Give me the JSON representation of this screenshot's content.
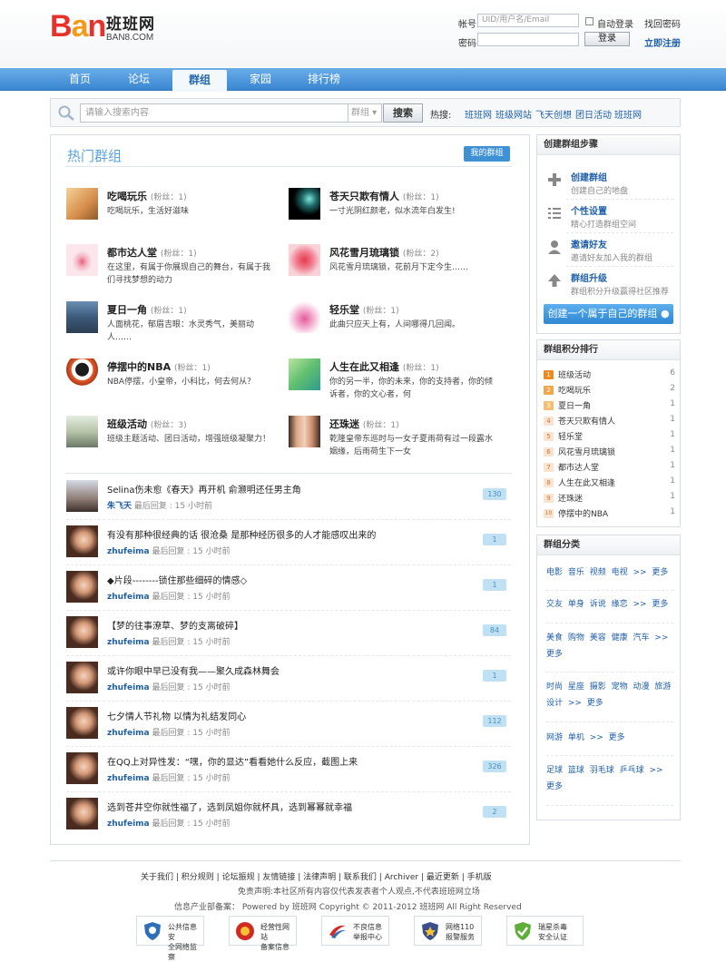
{
  "header": {
    "logo_text": "BAN",
    "logo_cn": "班班网",
    "logo_en": "BAN8.COM",
    "account_label": "帐号",
    "account_placeholder": "UID/用户名/Email",
    "password_label": "密码",
    "auto_login": "自动登录",
    "forgot": "找回密码",
    "login_btn": "登录",
    "register": "立即注册"
  },
  "nav": {
    "items": [
      "首页",
      "论坛",
      "群组",
      "家园",
      "排行榜"
    ],
    "active": "群组"
  },
  "search": {
    "placeholder": "请输入搜索内容",
    "scope": "群组",
    "button": "搜索",
    "hot_label": "热搜:",
    "hot_tags": [
      "班班网",
      "班级网站",
      "飞天创想",
      "团日活动",
      "班班网"
    ]
  },
  "main": {
    "title": "热门群组",
    "mine_btn": "我的群组",
    "fans_label": "粉丝：",
    "groups": [
      {
        "name": "吃喝玩乐",
        "fans": "1",
        "desc": "吃喝玩乐，生活好滋味"
      },
      {
        "name": "苍天只欺有情人",
        "fans": "1",
        "desc": "一寸光阴红颜老，似水流年白发生!"
      },
      {
        "name": "都市达人堂",
        "fans": "1",
        "desc": "在这里，有属于你展现自己的舞台，有属于我们寻找梦想的动力"
      },
      {
        "name": "风花雪月琉璃锁",
        "fans": "2",
        "desc": "风花雪月琉璃锁，花前月下定今生……"
      },
      {
        "name": "夏日一角",
        "fans": "1",
        "desc": "人面桃花，郁眉吉眼：水灵秀气，美丽动人……"
      },
      {
        "name": "轻乐堂",
        "fans": "1",
        "desc": "此曲只应天上有，人间哪得几回闻。"
      },
      {
        "name": "停摆中的NBA",
        "fans": "1",
        "desc": "NBA停摆，小皇帝，小科比，何去何从？"
      },
      {
        "name": "人生在此又相逢",
        "fans": "1",
        "desc": "你的另一半，你的未来，你的支持者，你的倾诉者，你的文心者，何"
      },
      {
        "name": "班级活动",
        "fans": "3",
        "desc": "班级主题活动、团日活动，增强班级凝聚力！"
      },
      {
        "name": "还珠迷",
        "fans": "1",
        "desc": "乾隆皇帝东巡时与一女子夏雨荷有过一段露水姻缘，后雨荷生下一女"
      }
    ],
    "last_reply_label": "最后回复 :",
    "topics": [
      {
        "title": "Selina伤未愈《春天》再开机 俞灏明还任男主角",
        "user": "朱飞天",
        "time": "15 小时前",
        "count": "130"
      },
      {
        "title": "有没有那种很经典的话 很沧桑 是那种经历很多的人才能感叹出来的",
        "user": "zhufeima",
        "time": "15 小时前",
        "count": "1"
      },
      {
        "title": "◆片段--------锁住那些细碎的情感◇",
        "user": "zhufeima",
        "time": "15 小时前",
        "count": "1"
      },
      {
        "title": "【梦的往事潦草、梦的支离破碎】",
        "user": "zhufeima",
        "time": "15 小时前",
        "count": "84"
      },
      {
        "title": "或许你眼中早已没有我——聚久成森林舞会",
        "user": "zhufeima",
        "time": "15 小时前",
        "count": "1"
      },
      {
        "title": "七夕情人节礼物 以情为礼结发同心",
        "user": "zhufeima",
        "time": "15 小时前",
        "count": "112"
      },
      {
        "title": "在QQ上对异性发：“嘿，你的显达”看看她什么反应，截图上来",
        "user": "zhufeima",
        "time": "15 小时前",
        "count": "326"
      },
      {
        "title": "选到苍井空你就性福了，选到凤姐你就杯具，选到幂幂就幸福",
        "user": "zhufeima",
        "time": "15 小时前",
        "count": "2"
      }
    ]
  },
  "steps": {
    "title": "创建群组步骤",
    "items": [
      {
        "title": "创建群组",
        "desc": "创建自己的地盘"
      },
      {
        "title": "个性设置",
        "desc": "精心打造群组空间"
      },
      {
        "title": "邀请好友",
        "desc": "邀请好友加入我的群组"
      },
      {
        "title": "群组升级",
        "desc": "群组积分升级赢得社区推荐"
      }
    ],
    "create_btn": "创建一个属于自己的群组"
  },
  "ranking": {
    "title": "群组积分排行",
    "items": [
      {
        "rank": "1",
        "name": "班级活动",
        "score": "6"
      },
      {
        "rank": "2",
        "name": "吃喝玩乐",
        "score": "2"
      },
      {
        "rank": "3",
        "name": "夏日一角",
        "score": "1"
      },
      {
        "rank": "4",
        "name": "苍天只欺有情人",
        "score": "1"
      },
      {
        "rank": "5",
        "name": "轻乐堂",
        "score": "1"
      },
      {
        "rank": "6",
        "name": "风花雪月琉璃锁",
        "score": "1"
      },
      {
        "rank": "7",
        "name": "都市达人堂",
        "score": "1"
      },
      {
        "rank": "8",
        "name": "人生在此又相逢",
        "score": "1"
      },
      {
        "rank": "9",
        "name": "还珠迷",
        "score": "1"
      },
      {
        "rank": "10",
        "name": "停摆中的NBA",
        "score": "1"
      }
    ]
  },
  "categories": {
    "title": "群组分类",
    "rows": [
      "电影 音乐 视频 电视 >> 更多",
      "交友 单身 诉说 缘恋 >> 更多",
      "美食 购物 美容 健康 汽车 >> 更多",
      "时尚 星座 摄影 宠物 动漫 旅游 设计 >> 更多",
      "网游 单机 >> 更多",
      "足球 篮球 羽毛球 乒乓球 >> 更多"
    ]
  },
  "footer": {
    "links": [
      "关于我们",
      "积分规则",
      "论坛振规",
      "友情链接",
      "法律声明",
      "联系我们",
      "Archiver",
      "最近更新",
      "手机版"
    ],
    "disclaimer": "免责声明:本社区所有内容仅代表发表者个人观点,不代表班班网立场",
    "icp": "信息产业部备案： Powered by 班班网 Copyright © 2011-2012 班班网 All Right Reserved",
    "badges": [
      {
        "line1": "公共信息安",
        "line2": "全网络监察"
      },
      {
        "line1": "经营性网站",
        "line2": "备案信息"
      },
      {
        "line1": "不良信息",
        "line2": "举报中心"
      },
      {
        "line1": "网络110",
        "line2": "报警服务"
      },
      {
        "line1": "瑞星杀毒",
        "line2": "安全认证"
      }
    ]
  },
  "colors": {
    "nav_blue": "#3a86d2",
    "link_blue": "#1f5fa8",
    "title_blue": "#5aa3d8",
    "rank_orange": "#f08a1e",
    "rank_grey": "#f3b482"
  }
}
